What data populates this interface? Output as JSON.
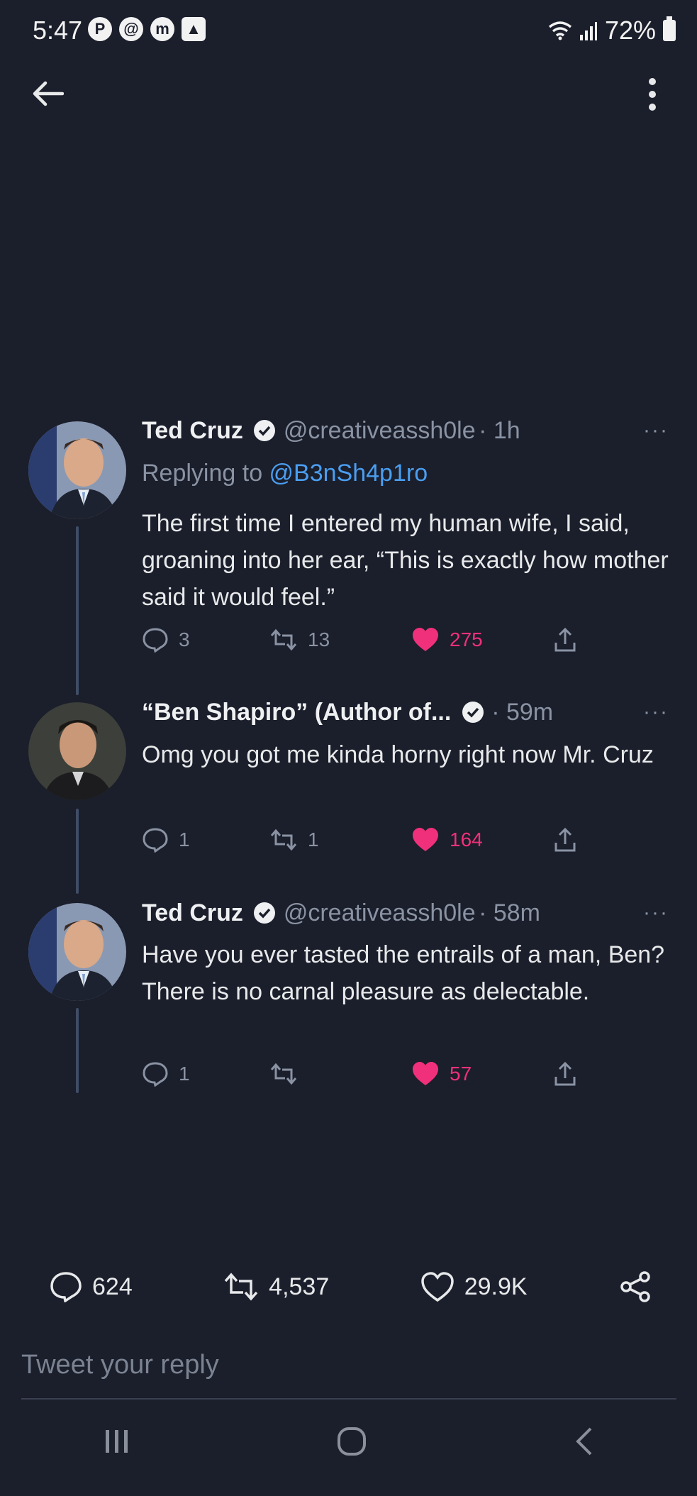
{
  "status_bar": {
    "time": "5:47",
    "notification_icons": [
      "p-icon",
      "threads-icon",
      "mastodon-icon",
      "image-icon"
    ],
    "battery": "72%"
  },
  "header": {
    "back_icon": "back-arrow-icon",
    "menu_icon": "more-vertical-icon"
  },
  "tweets": [
    {
      "name": "Ted Cruz",
      "handle": "@creativeassh0le",
      "time": "· 1h",
      "replying_prefix": "Replying to ",
      "replying_to": "@B3nSh4p1ro",
      "text": "The first time I entered my human wife, I said, groaning into her ear, “This is exactly how mother said it would feel.”",
      "replies": "3",
      "retweets": "13",
      "likes": "275"
    },
    {
      "name": "“Ben Shapiro” (Author of...",
      "time": "· 59m",
      "text": "Omg you got me kinda horny right now Mr. Cruz",
      "replies": "1",
      "retweets": "1",
      "likes": "164"
    },
    {
      "name": "Ted Cruz",
      "handle": "@creativeassh0le",
      "time": "· 58m",
      "text": "Have you ever tasted the entrails of a man, Ben? There is no carnal pleasure as delectable.",
      "replies": "1",
      "retweets": "",
      "likes": "57"
    }
  ],
  "more_label": "···",
  "stats": {
    "replies": "624",
    "retweets": "4,537",
    "likes": "29.9K"
  },
  "reply_box": {
    "placeholder": "Tweet your reply"
  },
  "colors": {
    "background": "#1b1e2b",
    "accent": "#4a9ef0",
    "like": "#f0307a",
    "muted": "#8a93a3"
  }
}
